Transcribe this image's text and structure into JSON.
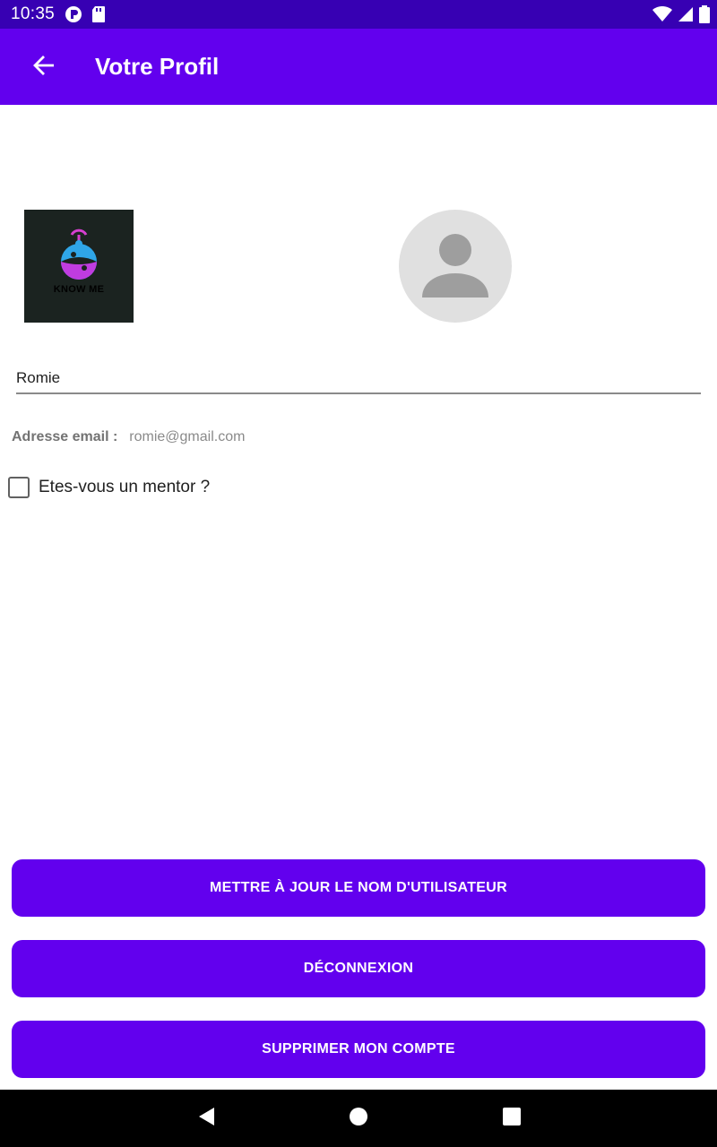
{
  "status_bar": {
    "time": "10:35",
    "left_icons": [
      "sync-icon",
      "sd-card-icon"
    ],
    "right_icons": [
      "wifi-icon",
      "signal-icon",
      "battery-icon"
    ]
  },
  "app_bar": {
    "title": "Votre Profil",
    "back_icon": "arrow-back-icon"
  },
  "profile": {
    "logo_text": "KNOW ME",
    "avatar_icon": "person-icon",
    "username": "Romie",
    "email_label": "Adresse email :",
    "email_value": "romie@gmail.com",
    "mentor_label": "Etes-vous un mentor ?",
    "mentor_checked": false
  },
  "actions": {
    "update_username": "METTRE À JOUR LE NOM D'UTILISATEUR",
    "logout": "DÉCONNEXION",
    "delete_account": "SUPPRIMER MON COMPTE"
  },
  "nav_bar": {
    "icons": [
      "back-triangle-icon",
      "home-circle-icon",
      "recents-square-icon"
    ]
  },
  "colors": {
    "status_bar": "#3700b3",
    "primary": "#6200ee",
    "nav_bar": "#000000"
  }
}
